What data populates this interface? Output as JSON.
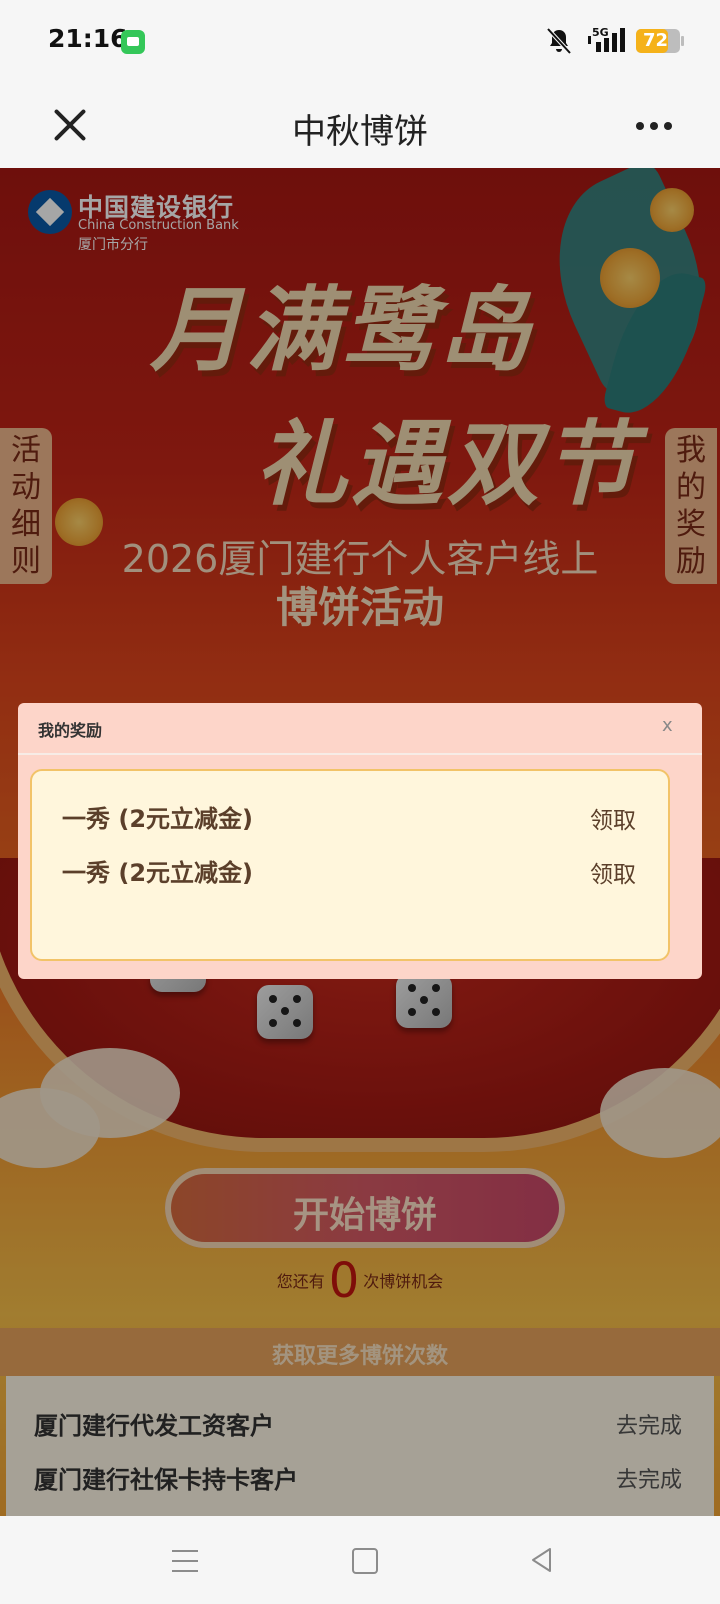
{
  "status_bar": {
    "time": "21:16",
    "network": "5G",
    "battery": "72",
    "battery_level": 0.72,
    "colors": {
      "battery": "#f5b21a",
      "message_app": "#34c759"
    }
  },
  "navbar": {
    "title": "中秋博饼"
  },
  "bank": {
    "name_cn": "中国建设银行",
    "name_en": "China Construction Bank",
    "branch": "厦门市分行"
  },
  "banner": {
    "headline_line1": "月满鹭岛",
    "headline_line2": "礼遇双节",
    "subtitle_line1": "2026厦门建行个人客户线上",
    "subtitle_line2": "博饼活动"
  },
  "side_tabs": {
    "rules": "活动细则",
    "my_rewards": "我的奖励"
  },
  "start_button": {
    "label": "开始博饼"
  },
  "chance": {
    "prefix": "您还有",
    "count": "0",
    "suffix": "次博饼机会"
  },
  "more_chances": {
    "title": "获取更多博饼次数"
  },
  "tasks": [
    {
      "name": "厦门建行代发工资客户",
      "action": "去完成"
    },
    {
      "name": "厦门建行社保卡持卡客户",
      "action": "去完成"
    }
  ],
  "modal": {
    "title": "我的奖励",
    "close_label": "x",
    "rewards": [
      {
        "name": "一秀 (2元立减金)",
        "action": "领取"
      },
      {
        "name": "一秀 (2元立减金)",
        "action": "领取"
      }
    ]
  },
  "bottom_nav": {
    "icons": [
      "menu-icon",
      "home-icon",
      "back-icon"
    ]
  }
}
